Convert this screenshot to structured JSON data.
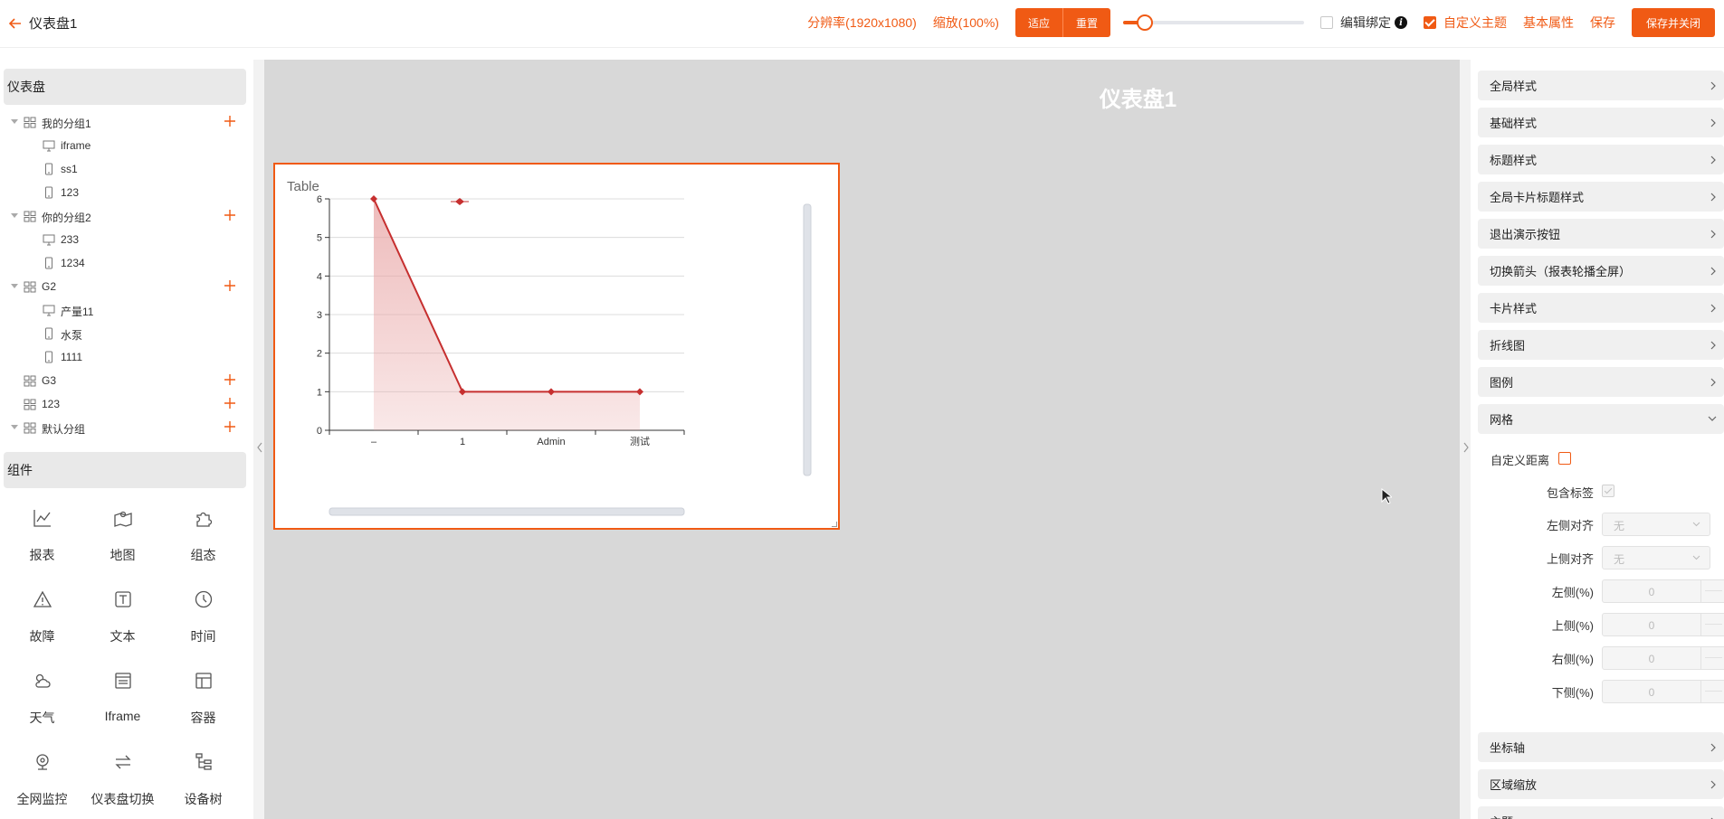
{
  "header": {
    "title": "仪表盘1",
    "resolution": "分辨率(1920x1080)",
    "zoom": "缩放(100%)",
    "fit_label": "适应",
    "reset_label": "重置",
    "zoom_slider_percent": 12,
    "edit_bind_label": "编辑绑定",
    "custom_theme_label": "自定义主题",
    "custom_theme_checked": true,
    "basic_props_label": "基本属性",
    "save_label": "保存",
    "save_close_label": "保存并关闭"
  },
  "left_panel": {
    "dashboard_header": "仪表盘",
    "tree": [
      {
        "type": "group",
        "label": "我的分组1",
        "expanded": true
      },
      {
        "type": "pc",
        "label": "iframe"
      },
      {
        "type": "mobile",
        "label": "ss1"
      },
      {
        "type": "mobile",
        "label": "123"
      },
      {
        "type": "group",
        "label": "你的分组2",
        "expanded": true
      },
      {
        "type": "pc",
        "label": "233"
      },
      {
        "type": "mobile",
        "label": "1234"
      },
      {
        "type": "group",
        "label": "G2",
        "expanded": true
      },
      {
        "type": "pc",
        "label": "产量11"
      },
      {
        "type": "mobile",
        "label": "水泵"
      },
      {
        "type": "mobile",
        "label": "1111"
      },
      {
        "type": "group",
        "label": "G3",
        "expanded": false
      },
      {
        "type": "group",
        "label": "123",
        "expanded": false
      },
      {
        "type": "group",
        "label": "默认分组",
        "expanded": true
      }
    ],
    "components_header": "组件",
    "components": [
      {
        "label": "报表",
        "icon": "line-chart-icon"
      },
      {
        "label": "地图",
        "icon": "map-icon"
      },
      {
        "label": "组态",
        "icon": "puzzle-icon"
      },
      {
        "label": "故障",
        "icon": "warning-icon"
      },
      {
        "label": "文本",
        "icon": "text-icon"
      },
      {
        "label": "时间",
        "icon": "clock-icon"
      },
      {
        "label": "天气",
        "icon": "weather-icon"
      },
      {
        "label": "Iframe",
        "icon": "iframe-icon"
      },
      {
        "label": "容器",
        "icon": "container-icon"
      },
      {
        "label": "全网监控",
        "icon": "camera-icon"
      },
      {
        "label": "仪表盘切换",
        "icon": "switch-icon"
      },
      {
        "label": "设备树",
        "icon": "device-tree-icon"
      }
    ]
  },
  "canvas": {
    "title": "仪表盘1",
    "card_title": "Table"
  },
  "chart_data": {
    "type": "area",
    "categories": [
      "–",
      "1",
      "Admin",
      "测试"
    ],
    "values": [
      6,
      1,
      1,
      1
    ],
    "extra_point": {
      "x_between": [
        0,
        1
      ],
      "y": 6
    },
    "ylim": [
      0,
      6
    ],
    "yticks": [
      0,
      1,
      2,
      3,
      4,
      5,
      6
    ],
    "grid": true,
    "color": "#c62f2f",
    "fill_color": "#e8a4a4"
  },
  "right_panel": {
    "sections_top": [
      "全局样式",
      "基础样式",
      "标题样式",
      "全局卡片标题样式",
      "退出演示按钮",
      "切换箭头（报表轮播全屏）",
      "卡片样式",
      "折线图",
      "图例"
    ],
    "grid_section": {
      "label": "网格",
      "custom_distance_label": "自定义距离",
      "contain_label_label": "包含标签",
      "left_align_label": "左侧对齐",
      "left_align_value": "无",
      "top_align_label": "上侧对齐",
      "top_align_value": "无",
      "left_pct_label": "左侧(%)",
      "left_pct_value": "0",
      "top_pct_label": "上侧(%)",
      "top_pct_value": "0",
      "right_pct_label": "右侧(%)",
      "right_pct_value": "0",
      "bottom_pct_label": "下侧(%)",
      "bottom_pct_value": "0"
    },
    "sections_bottom": [
      "坐标轴",
      "区域缩放",
      "主题"
    ]
  },
  "colors": {
    "accent": "#f05a14",
    "canvas_bg": "#d8d8d8"
  }
}
